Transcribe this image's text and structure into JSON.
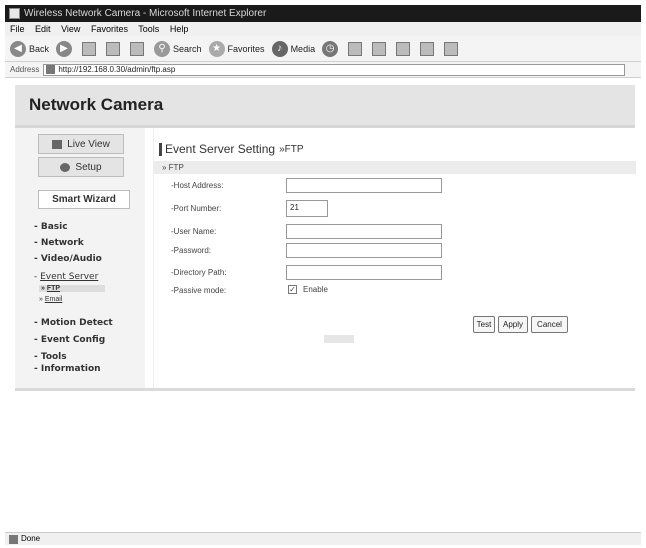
{
  "window": {
    "title": "Wireless Network Camera - Microsoft Internet Explorer"
  },
  "menu": [
    "File",
    "Edit",
    "View",
    "Favorites",
    "Tools",
    "Help"
  ],
  "toolbar": {
    "back": "Back",
    "search": "Search",
    "favorites": "Favorites",
    "media": "Media"
  },
  "address": {
    "label": "Address",
    "url": "http://192.168.0.30/admin/ftp.asp"
  },
  "header": {
    "brand": "Network Camera"
  },
  "sidebar": {
    "live_view": "Live View",
    "setup": "Setup",
    "smart_wizard": "Smart Wizard",
    "basic": "- Basic",
    "network": "- Network",
    "video_audio": "- Video/Audio",
    "event_server_prefix": "- ",
    "event_server": "Event Server",
    "ftp": "FTP",
    "email": "Email",
    "sub_prefix": "» ",
    "motion_detect": "- Motion Detect",
    "event_config": "- Event Config",
    "tools": "- Tools",
    "information": "- Information"
  },
  "content": {
    "title": "Event Server Setting",
    "title_suffix": "»FTP",
    "section": "» FTP",
    "fields": {
      "host_label": "-Host Address:",
      "host_value": "",
      "port_label": "-Port Number:",
      "port_value": "21",
      "user_label": "-User Name:",
      "user_value": "",
      "password_label": "-Password:",
      "password_value": "",
      "dir_label": "-Directory Path:",
      "dir_value": "",
      "passive_label": "-Passive mode:",
      "passive_enable": "Enable",
      "passive_checked": "✓"
    },
    "buttons": {
      "test": "Test",
      "apply": "Apply",
      "cancel": "Cancel"
    }
  },
  "status": {
    "text": "Done"
  }
}
